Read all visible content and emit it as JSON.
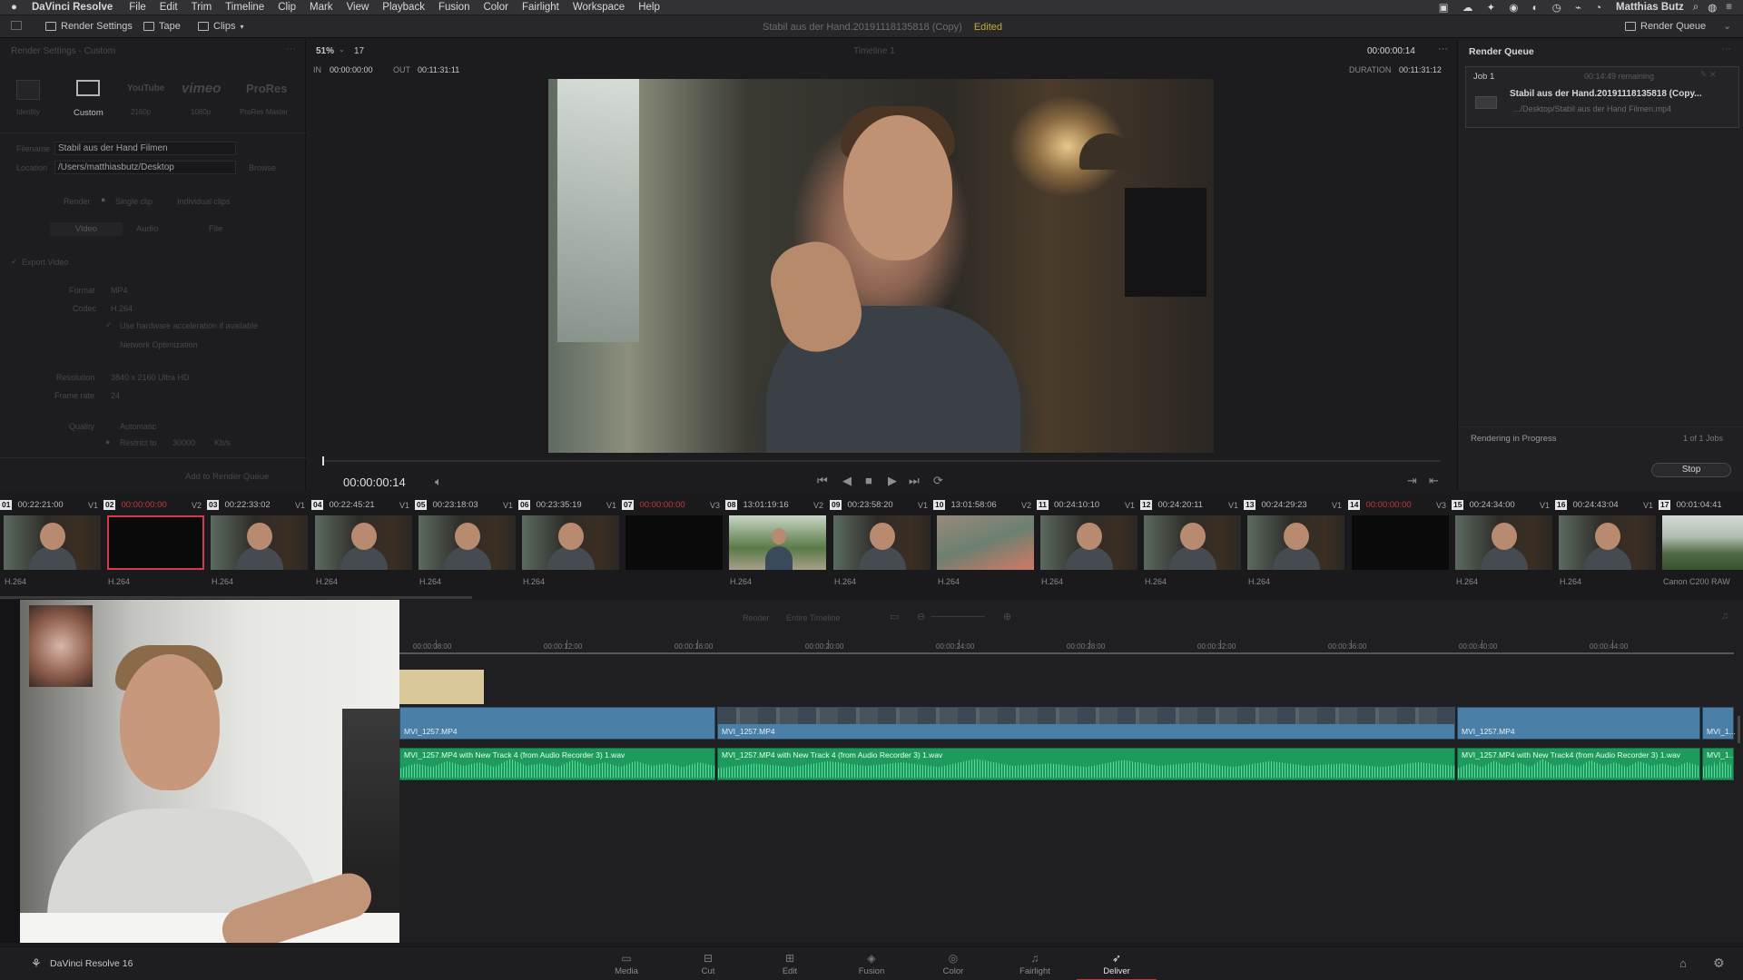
{
  "menubar": {
    "app_name": "DaVinci Resolve",
    "items": [
      "File",
      "Edit",
      "Trim",
      "Timeline",
      "Clip",
      "Mark",
      "View",
      "Playback",
      "Fusion",
      "Color",
      "Fairlight",
      "Workspace",
      "Help"
    ],
    "user": "Matthias Butz"
  },
  "toolbar": {
    "render_settings": "Render Settings",
    "tape": "Tape",
    "clips": "Clips",
    "project_title": "Stabil aus der Hand.20191118135818 (Copy)",
    "edited": "Edited",
    "render_queue": "Render Queue"
  },
  "render_settings": {
    "panel_title": "Render Settings - Custom",
    "presets": [
      "Custom",
      "YouTube",
      "vimeo",
      "ProRes"
    ],
    "preset_sub": [
      "Identity",
      "Custom",
      "2160p",
      "1080p",
      "ProRes Master"
    ],
    "filename_label": "Filename",
    "filename_value": "Stabil aus der Hand Filmen",
    "location_label": "Location",
    "location_value": "/Users/matthiasbutz/Desktop",
    "browse": "Browse",
    "render_label": "Render",
    "single_clip": "Single clip",
    "individual_clips": "Individual clips",
    "tabs": [
      "Video",
      "Audio",
      "File"
    ],
    "export_video": "Export Video",
    "format_label": "Format",
    "format_value": "MP4",
    "codec_label": "Codec",
    "codec_value": "H.264",
    "hw_accel": "Use hardware acceleration if available",
    "network_opt": "Network Optimization",
    "resolution_label": "Resolution",
    "resolution_value": "3840 x 2160 Ultra HD",
    "framerate_label": "Frame rate",
    "framerate_value": "24",
    "quality_label": "Quality",
    "quality_value": "Automatic",
    "restrict_label": "Restrict to",
    "restrict_value": "30000",
    "kbps": "Kb/s",
    "add_to_queue": "Add to Render Queue"
  },
  "viewer": {
    "zoom": "51%",
    "frame_num": "17",
    "timeline_name": "Timeline 1",
    "timecode_top": "00:00:00:14",
    "in_label": "IN",
    "in_value": "00:00:00:00",
    "out_label": "OUT",
    "out_value": "00:11:31:11",
    "duration_label": "DURATION",
    "duration_value": "00:11:31:12",
    "current_tc": "00:00:00:14"
  },
  "render_queue": {
    "title": "Render Queue",
    "job_label": "Job 1",
    "remaining": "00:14:49 remaining",
    "job_title": "Stabil aus der Hand.20191118135818 (Copy...",
    "job_path": ".../Desktop/Stabil aus der Hand Filmen.mp4",
    "status": "Rendering in Progress",
    "count": "1 of 1 Jobs",
    "stop": "Stop"
  },
  "clips": [
    {
      "num": "01",
      "tc": "00:22:21:00",
      "track": "V1",
      "codec": "H.264",
      "kind": "person",
      "red": false
    },
    {
      "num": "02",
      "tc": "00:00:00:00",
      "track": "V2",
      "codec": "H.264",
      "kind": "black-sel",
      "red": true
    },
    {
      "num": "03",
      "tc": "00:22:33:02",
      "track": "V1",
      "codec": "H.264",
      "kind": "person",
      "red": false
    },
    {
      "num": "04",
      "tc": "00:22:45:21",
      "track": "V1",
      "codec": "H.264",
      "kind": "person",
      "red": false
    },
    {
      "num": "05",
      "tc": "00:23:18:03",
      "track": "V1",
      "codec": "H.264",
      "kind": "person",
      "red": false
    },
    {
      "num": "06",
      "tc": "00:23:35:19",
      "track": "V1",
      "codec": "H.264",
      "kind": "person",
      "red": false
    },
    {
      "num": "07",
      "tc": "00:00:00:00",
      "track": "V3",
      "codec": "",
      "kind": "black",
      "red": true
    },
    {
      "num": "08",
      "tc": "13:01:19:16",
      "track": "V2",
      "codec": "H.264",
      "kind": "outdoor",
      "red": false
    },
    {
      "num": "09",
      "tc": "00:23:58:20",
      "track": "V1",
      "codec": "H.264",
      "kind": "person",
      "red": false
    },
    {
      "num": "10",
      "tc": "13:01:58:06",
      "track": "V2",
      "codec": "H.264",
      "kind": "water",
      "red": false
    },
    {
      "num": "11",
      "tc": "00:24:10:10",
      "track": "V1",
      "codec": "H.264",
      "kind": "person",
      "red": false
    },
    {
      "num": "12",
      "tc": "00:24:20:11",
      "track": "V1",
      "codec": "H.264",
      "kind": "person",
      "red": false
    },
    {
      "num": "13",
      "tc": "00:24:29:23",
      "track": "V1",
      "codec": "H.264",
      "kind": "person",
      "red": false
    },
    {
      "num": "14",
      "tc": "00:00:00:00",
      "track": "V3",
      "codec": "",
      "kind": "black",
      "red": true
    },
    {
      "num": "15",
      "tc": "00:24:34:00",
      "track": "V1",
      "codec": "H.264",
      "kind": "person",
      "red": false
    },
    {
      "num": "16",
      "tc": "00:24:43:04",
      "track": "V1",
      "codec": "H.264",
      "kind": "person",
      "red": false
    },
    {
      "num": "17",
      "tc": "00:01:04:41",
      "track": "",
      "codec": "Canon C200 RAW",
      "kind": "field",
      "red": false
    }
  ],
  "timeline": {
    "render_label": "Render",
    "render_value": "Entire Timeline",
    "ruler": [
      "00:00:08:00",
      "00:00:12:00",
      "00:00:16:00",
      "00:00:20:00",
      "00:00:24:00",
      "00:00:28:00",
      "00:00:32:00",
      "00:00:36:00",
      "00:00:40:00",
      "00:00:44:00"
    ],
    "video_clips": [
      "MVI_1257.MP4",
      "MVI_1257.MP4",
      "MVI_1257.MP4",
      "MVI_1..."
    ],
    "audio_clips": [
      "MVI_1257.MP4 with New Track 4 (from Audio Recorder 3) 1.wav",
      "MVI_1257.MP4 with New Track 4 (from Audio Recorder 3) 1.wav",
      "MVI_1257.MP4 with New Track4 (from Audio Recorder 3) 1.wav",
      "MVI_1..."
    ]
  },
  "pages": [
    {
      "label": "Media",
      "icon": "media-icon",
      "glyph": "▭"
    },
    {
      "label": "Cut",
      "icon": "cut-icon",
      "glyph": "⊟"
    },
    {
      "label": "Edit",
      "icon": "edit-icon",
      "glyph": "⊞"
    },
    {
      "label": "Fusion",
      "icon": "fusion-icon",
      "glyph": "◈"
    },
    {
      "label": "Color",
      "icon": "color-icon",
      "glyph": "◎"
    },
    {
      "label": "Fairlight",
      "icon": "fairlight-icon",
      "glyph": "♫"
    },
    {
      "label": "Deliver",
      "icon": "deliver-icon",
      "glyph": "➶"
    }
  ],
  "active_page": "Deliver",
  "footer_app": "DaVinci Resolve 16",
  "colors": {
    "accent": "#cf3040",
    "video_clip": "#4a7fa8",
    "audio_clip": "#1f9a5e"
  }
}
